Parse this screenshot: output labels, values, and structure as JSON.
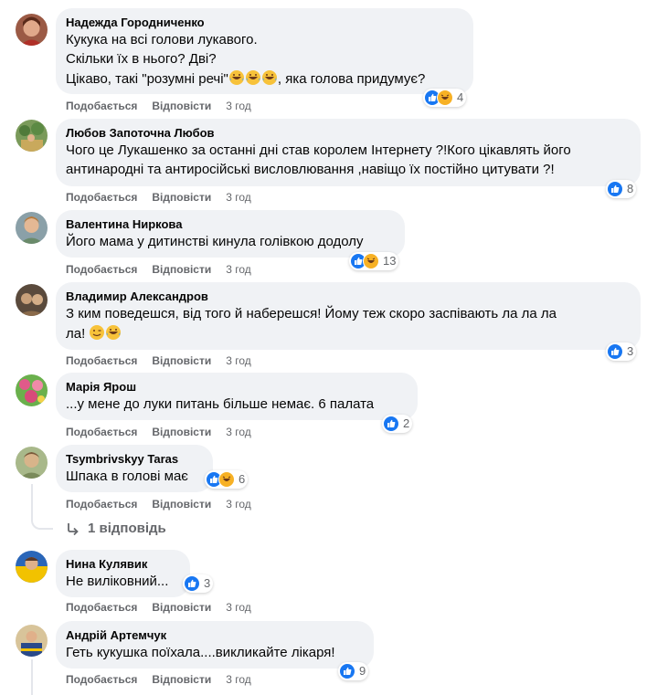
{
  "actions": {
    "like": "Подобається",
    "reply": "Відповісти"
  },
  "top_fragment": "· · · · · · · · · · · · · · · · · ·",
  "comments": [
    {
      "author": "Надежда Городниченко",
      "lines": [
        "Кукука на всі голови лукавого.",
        "Скільки їх в нього? Дві?",
        "Цікаво, такі \"розумні речі\"",
        ", яка голова придумує?"
      ],
      "reactions": [
        "like",
        "haha"
      ],
      "count": "4",
      "time": "3 год",
      "avatar_colors": [
        "#8b3a2a",
        "#d89a7c"
      ]
    },
    {
      "author": "Любов Запоточна Любов",
      "lines": [
        "Чого це Лукашенко за останні дні став королем Інтернету ?!Кого цікавлять його",
        "антинародні та антиросійські висловлювання ,навіщо їх постійно цитувати ?!"
      ],
      "reactions": [
        "like"
      ],
      "count": "8",
      "time": "3 год",
      "avatar_colors": [
        "#6f8f4c",
        "#c7a85c"
      ]
    },
    {
      "author": "Валентина Ниркова",
      "lines": [
        "Його мама у дитинстві кинула голівкою додолу"
      ],
      "reactions": [
        "like",
        "haha"
      ],
      "count": "13",
      "time": "3 год",
      "avatar_colors": [
        "#7a8f9a",
        "#e0b08a"
      ]
    },
    {
      "author": "Владимир Александров",
      "lines": [
        "З ким поведешся, від того й наберешся! Йому теж скоро заспівають ла ла ла",
        "ла! "
      ],
      "reactions": [
        "like"
      ],
      "count": "3",
      "time": "3 год",
      "avatar_colors": [
        "#5a4a3c",
        "#b0987a"
      ]
    },
    {
      "author": "Марія Ярош",
      "lines": [
        "...у мене до луки питань більше немає. 6 палата"
      ],
      "reactions": [
        "like"
      ],
      "count": "2",
      "time": "3 год",
      "avatar_colors": [
        "#e05a8a",
        "#6ab04c"
      ]
    },
    {
      "author": "Tsymbrivskyy Taras",
      "lines": [
        "Шпака в голові має"
      ],
      "reactions": [
        "like",
        "haha"
      ],
      "count": "6",
      "time": "3 год",
      "avatar_colors": [
        "#8a9a6a",
        "#d0c0a0"
      ]
    },
    {
      "author": "Нина Кулявик",
      "lines": [
        "Не виліковний..."
      ],
      "reactions": [
        "like"
      ],
      "count": "3",
      "time": "3 год",
      "avatar_colors": [
        "#f2c200",
        "#2a66b8"
      ]
    },
    {
      "author": "Андрій Артемчук",
      "lines": [
        "Геть кукушка поїхала....викликайте лікаря!"
      ],
      "reactions": [
        "like"
      ],
      "count": "9",
      "time": "3 год",
      "avatar_colors": [
        "#d8c49a",
        "#3a5a8a"
      ]
    }
  ],
  "replies_link": "1 відповідь"
}
